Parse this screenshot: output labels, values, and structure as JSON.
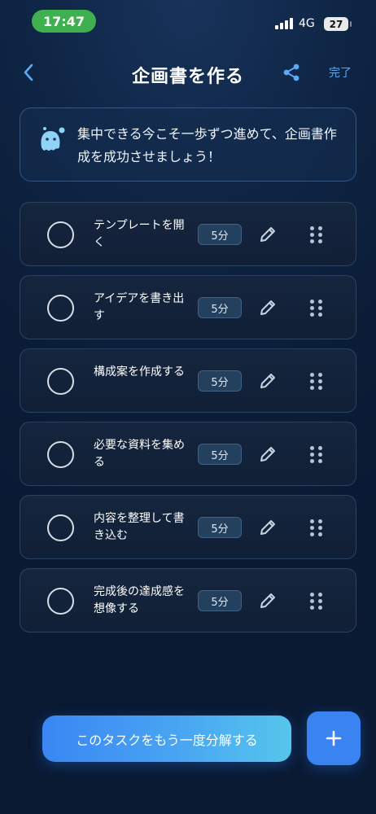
{
  "status_bar": {
    "time": "17:47",
    "network": "4G",
    "battery": "27"
  },
  "header": {
    "title": "企画書を作る",
    "done_label": "完了"
  },
  "motivation": {
    "text": "集中できる今こそ一歩ずつ進めて、企画書作成を成功させましょう！"
  },
  "tasks": [
    {
      "title": "テンプレートを開く",
      "duration": "5分"
    },
    {
      "title": "アイデアを書き出す",
      "duration": "5分"
    },
    {
      "title": "構成案を作成する",
      "duration": "5分"
    },
    {
      "title": "必要な資料を集める",
      "duration": "5分"
    },
    {
      "title": "内容を整理して書き込む",
      "duration": "5分"
    },
    {
      "title": "完成後の達成感を想像する",
      "duration": "5分"
    }
  ],
  "footer": {
    "decompose_label": "このタスクをもう一度分解する"
  },
  "colors": {
    "accent": "#3a84f2",
    "link": "#5aaaf5",
    "time_pill": "#3fb04f"
  }
}
